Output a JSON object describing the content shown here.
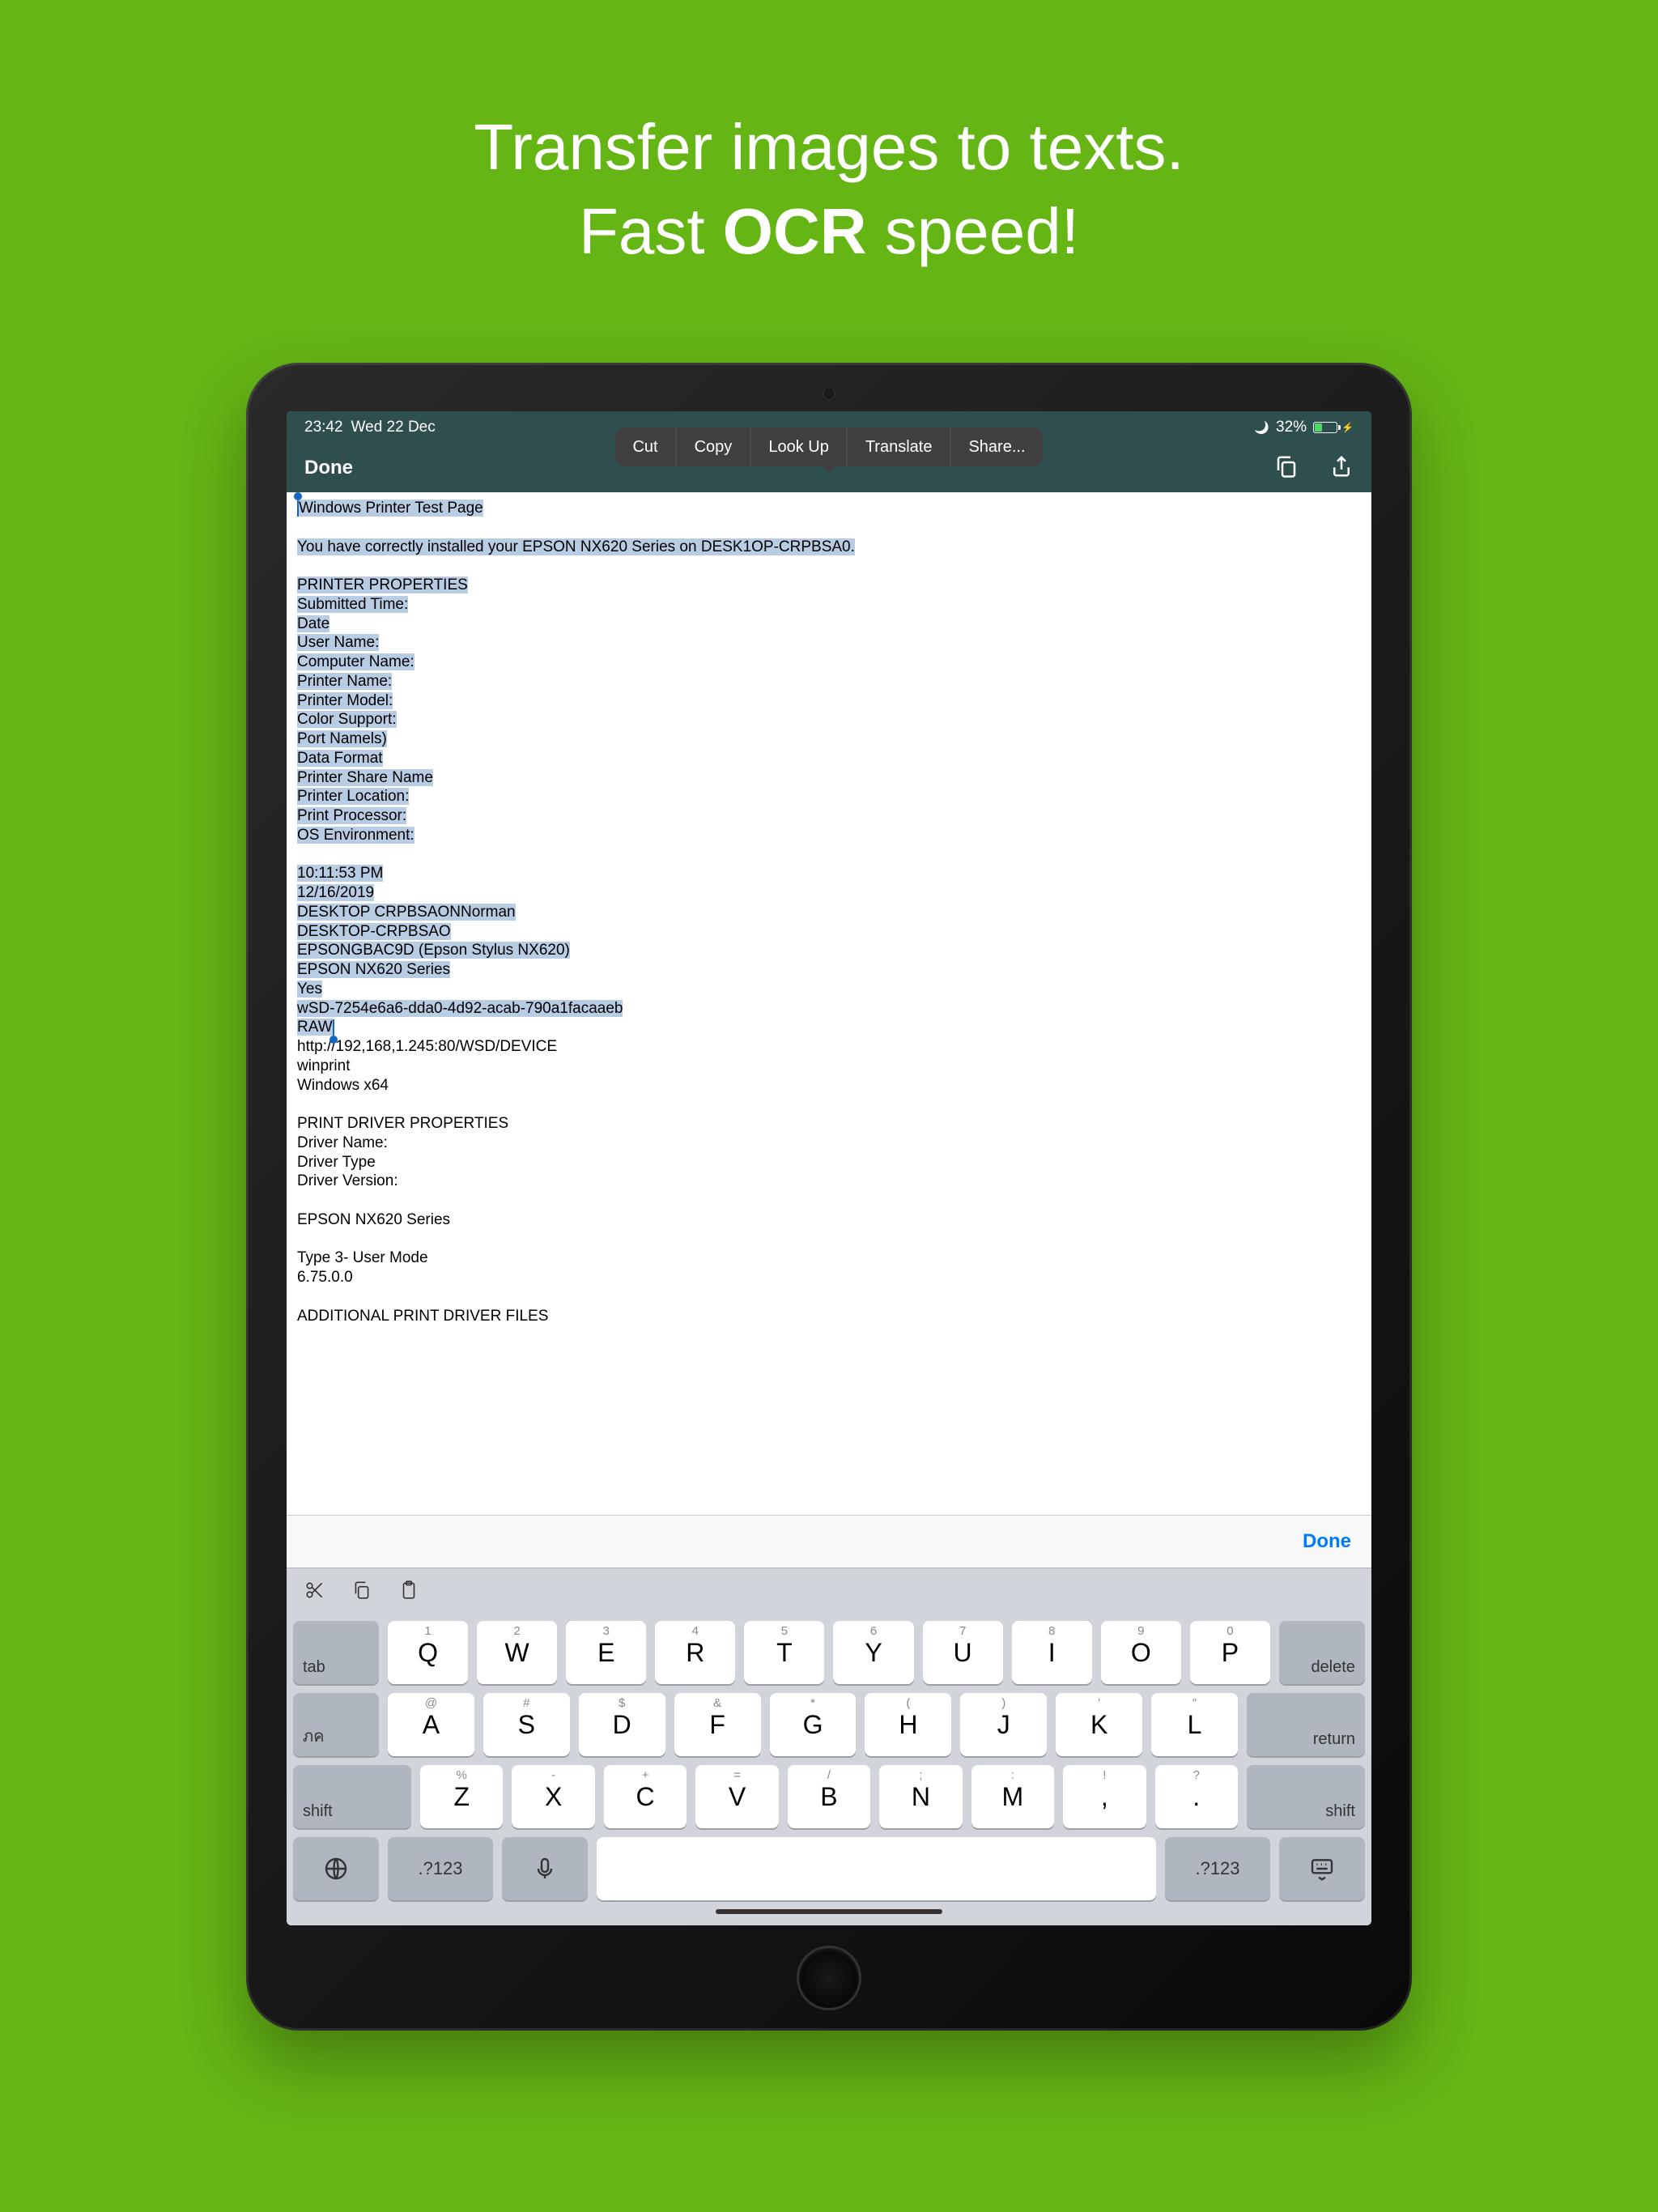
{
  "promo": {
    "line1": "Transfer images to texts.",
    "line2_a": "Fast ",
    "line2_b": "OCR",
    "line2_c": " speed!"
  },
  "status": {
    "time": "23:42",
    "date": "Wed 22 Dec",
    "battery": "32%"
  },
  "toolbar": {
    "done": "Done"
  },
  "menu": {
    "cut": "Cut",
    "copy": "Copy",
    "lookup": "Look Up",
    "translate": "Translate",
    "share": "Share..."
  },
  "text": {
    "selected": "Windows Printer Test Page\n\nYou have correctly installed your EPSON NX620 Series on DESK1OP-CRPBSA0.\n\nPRINTER PROPERTIES\nSubmitted Time:\nDate\nUser Name:\nComputer Name:\nPrinter Name:\nPrinter Model:\nColor Support:\nPort Namels)\nData Format\nPrinter Share Name\nPrinter Location:\nPrint Processor:\nOS Environment:\n\n10:11:53 PM\n12/16/2019\nDESKTOP CRPBSAONNorman\nDESKTOP-CRPBSAO\nEPSONGBAC9D (Epson Stylus NX620)\nEPSON NX620 Series\nYes\nwSD-7254e6a6-dda0-4d92-acab-790a1facaaeb\nRAW",
    "after": "\nhttp://192,168,1.245:80/WSD/DEVICE\nwinprint\nWindows x64\n\nPRINT DRIVER PROPERTIES\nDriver Name:\nDriver Type\nDriver Version:\n\nEPSON NX620 Series\n\nType 3- User Mode\n6.75.0.0\n\nADDITIONAL PRINT DRIVER FILES"
  },
  "kb": {
    "done": "Done",
    "row1_alt": [
      "1",
      "2",
      "3",
      "4",
      "5",
      "6",
      "7",
      "8",
      "9",
      "0"
    ],
    "row1": [
      "Q",
      "W",
      "E",
      "R",
      "T",
      "Y",
      "U",
      "I",
      "O",
      "P"
    ],
    "row2_alt": [
      "@",
      "#",
      "$",
      "&",
      "*",
      "(",
      ")",
      "'",
      "\""
    ],
    "row2": [
      "A",
      "S",
      "D",
      "F",
      "G",
      "H",
      "J",
      "K",
      "L"
    ],
    "row3_alt": [
      "%",
      "-",
      "+",
      "=",
      "/",
      ";",
      ":",
      "!",
      "?"
    ],
    "row3": [
      "Z",
      "X",
      "C",
      "V",
      "B",
      "N",
      "M",
      ",",
      "."
    ],
    "tab": "tab",
    "delete": "delete",
    "lang": "ภค",
    "return": "return",
    "shift": "shift",
    "numsym": ".?123"
  }
}
